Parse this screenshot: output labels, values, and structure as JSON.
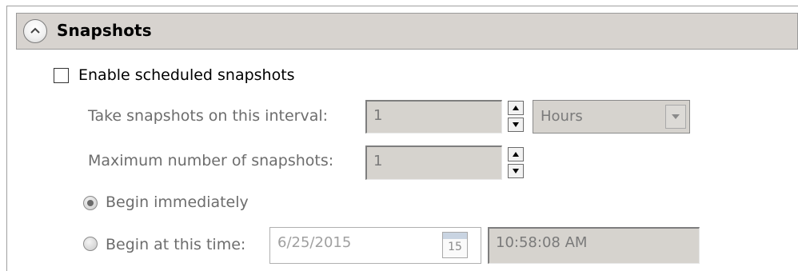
{
  "section": {
    "title": "Snapshots"
  },
  "enable": {
    "label": "Enable scheduled snapshots",
    "checked": false
  },
  "interval": {
    "label": "Take snapshots on this interval:",
    "value": "1",
    "unit": "Hours"
  },
  "max_snapshots": {
    "label": "Maximum number of snapshots:",
    "value": "1"
  },
  "begin_immediately": {
    "label": "Begin immediately",
    "selected": true
  },
  "begin_at_time": {
    "label": "Begin at this time:",
    "selected": false,
    "date": "6/25/2015",
    "calendar_day": "15",
    "time": "10:58:08 AM"
  },
  "icons": {
    "collapse": "chevron-up-icon",
    "spin_up": "triangle-up-icon",
    "spin_down": "triangle-down-icon",
    "dropdown": "triangle-down-icon",
    "calendar": "calendar-icon"
  }
}
